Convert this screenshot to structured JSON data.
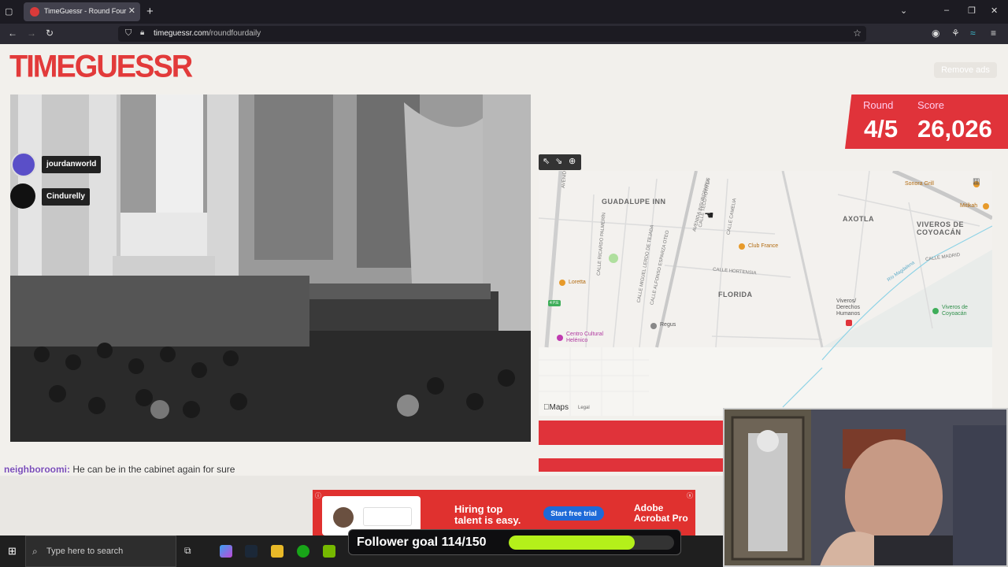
{
  "browser": {
    "tab_title": "TimeGuessr - Round Four",
    "url_host": "timeguessr.com",
    "url_path": "/roundfourdaily"
  },
  "page": {
    "logo": "TIMEGUESSR",
    "remove_ads": "Remove ads",
    "round_label": "Round",
    "round_value": "4/5",
    "score_label": "Score",
    "score_value": "26,026"
  },
  "chat_users": [
    "jourdanworld",
    "Cindurelly"
  ],
  "chat_message": {
    "user": "neighboroomi:",
    "text": " He can be in the cabinet again for sure"
  },
  "map": {
    "areas": [
      "GUADALUPE INN",
      "AXOTLA",
      "VIVEROS DE COYOACÁN",
      "FLORIDA"
    ],
    "streets": [
      "AVENIDA INSURGENTES",
      "CALLE TECOYOTITLA",
      "CALLE CAMELIA",
      "CALLE RICARDO PALMERÍN",
      "CALLE MIGUEL LERDO DE TEJADA",
      "CALLE ALFONSO ESPARZA OTEO",
      "CALLE HORTENSIA",
      "CALLE MADRID",
      "Río Magdalena",
      "AVENIDA"
    ],
    "pois": [
      "Sonora Grill",
      "Mitikah",
      "Club France",
      "Loretta",
      "Regus",
      "Centro Cultural Helénico",
      "Viveros/ Derechos Humanos",
      "Viveros de Coyoacán"
    ],
    "route_badge": "4 P.E",
    "maps_logo": "Maps",
    "legal": "Legal"
  },
  "ad": {
    "headline_1": "Hiring top",
    "headline_2": "talent is easy.",
    "cta": "Start free trial",
    "brand_1": "Adobe",
    "brand_2": "Acrobat Pro"
  },
  "taskbar": {
    "search_placeholder": "Type here to search"
  },
  "follower_goal": {
    "label": "Follower goal 114/150",
    "progress": 0.76
  },
  "colors": {
    "brand_red": "#e0333a",
    "goal_green": "#b4f01a"
  }
}
